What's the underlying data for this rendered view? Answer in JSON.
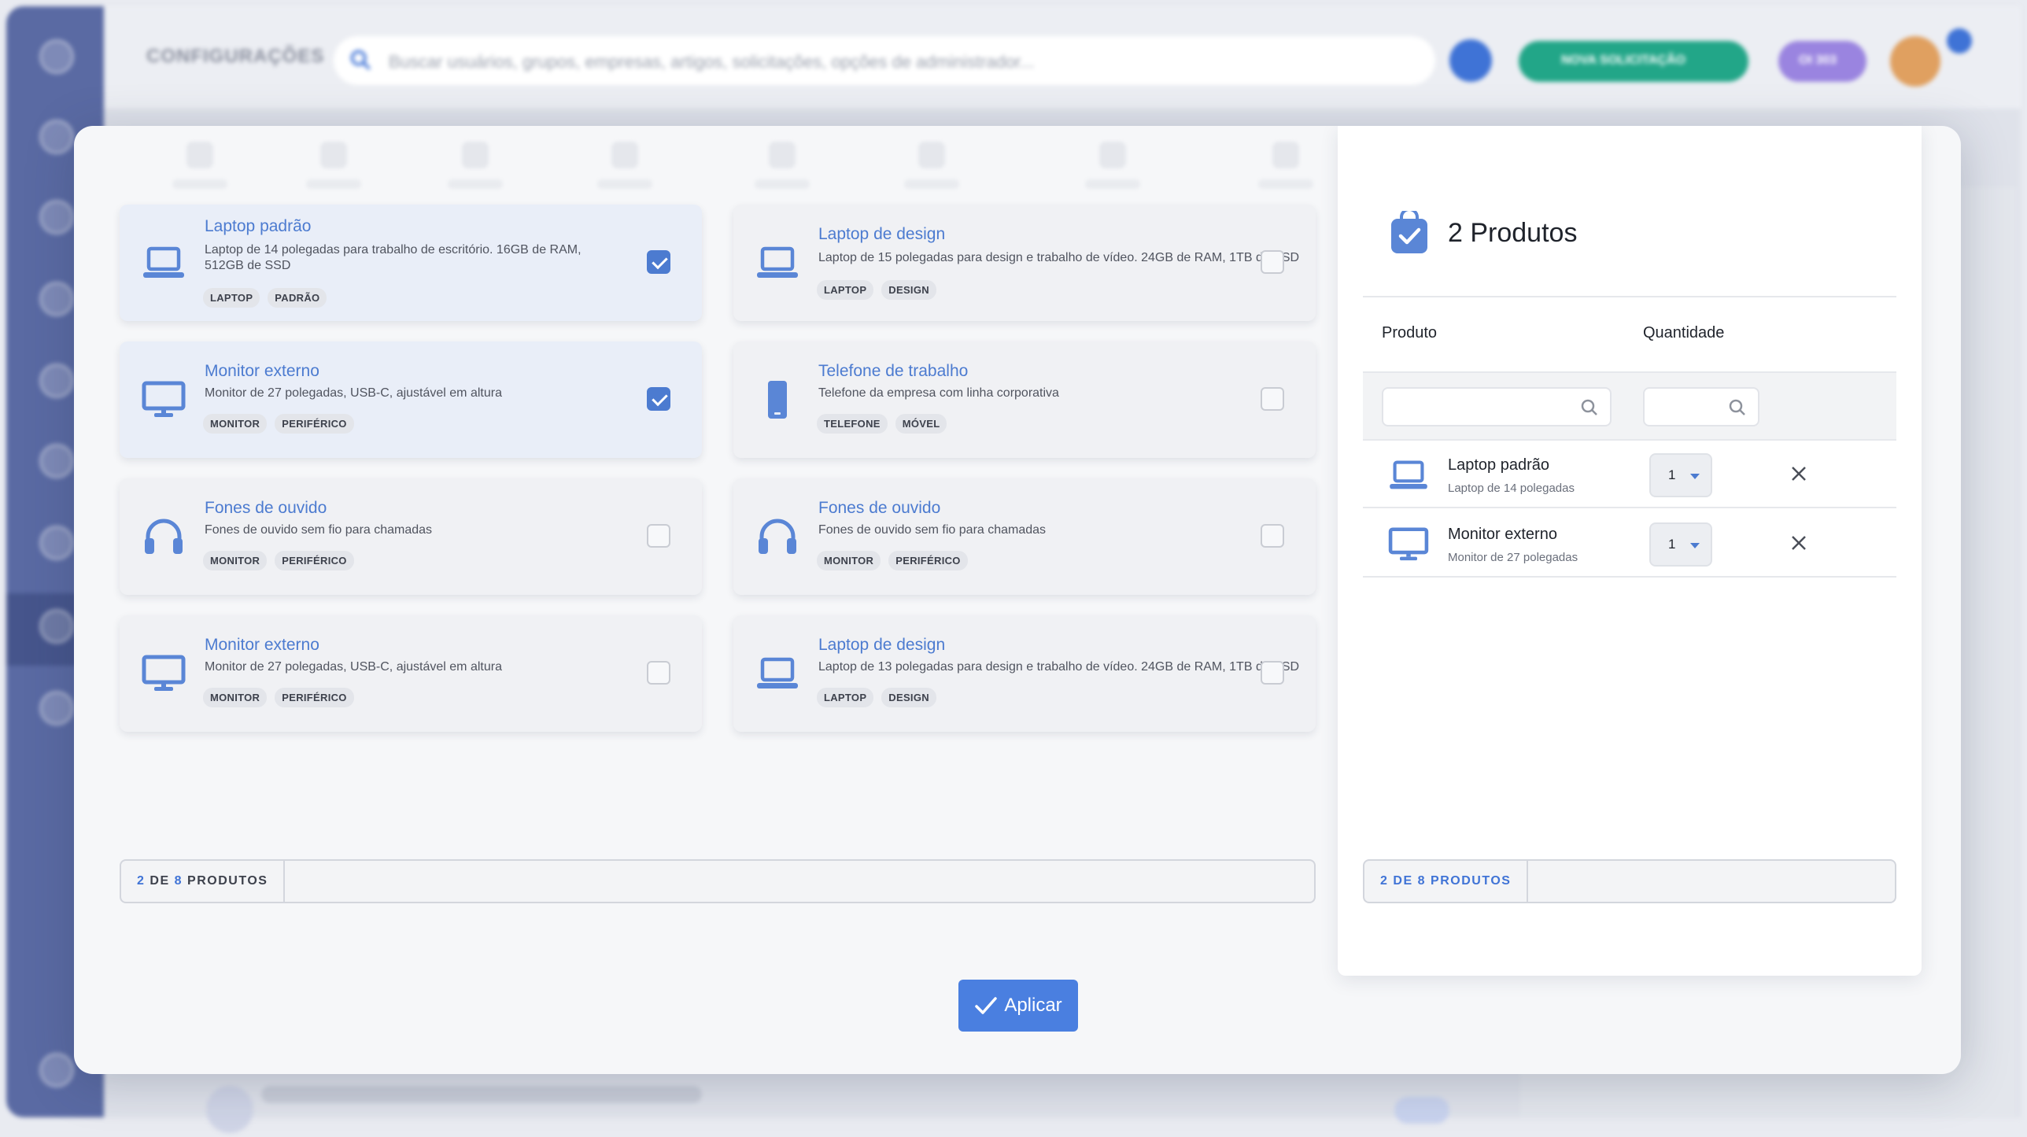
{
  "app": {
    "title": "CONFIGURAÇÕES",
    "search_placeholder": "Buscar usuários, grupos, empresas, artigos, solicitações, opções de administrador...",
    "new_request_label": "NOVA SOLICITAÇÃO",
    "pill_label": "OI 303",
    "accent": "#3f73d6"
  },
  "catalog": {
    "cards": [
      {
        "title": "Laptop padrão",
        "desc": "Laptop de 14 polegadas para trabalho de escritório. 16GB de RAM, 512GB de SSD",
        "tags": [
          "LAPTOP",
          "PADRÃO"
        ],
        "icon": "laptop-icon",
        "checked": true
      },
      {
        "title": "Laptop de design",
        "desc": "Laptop de 15 polegadas para design e trabalho de vídeo. 24GB de RAM, 1TB de SSD",
        "tags": [
          "LAPTOP",
          "DESIGN"
        ],
        "icon": "laptop-icon",
        "checked": false
      },
      {
        "title": "Monitor externo",
        "desc": "Monitor de 27 polegadas, USB-C, ajustável em altura",
        "tags": [
          "MONITOR",
          "PERIFÉRICO"
        ],
        "icon": "monitor-icon",
        "checked": true
      },
      {
        "title": "Telefone de trabalho",
        "desc": "Telefone da empresa com linha corporativa",
        "tags": [
          "TELEFONE",
          "MÓVEL"
        ],
        "icon": "phone-icon",
        "checked": false
      },
      {
        "title": "Fones de ouvido",
        "desc": "Fones de ouvido sem fio para chamadas",
        "tags": [
          "MONITOR",
          "PERIFÉRICO"
        ],
        "icon": "headphones-icon",
        "checked": false
      },
      {
        "title": "Fones de ouvido",
        "desc": "Fones de ouvido sem fio para chamadas",
        "tags": [
          "MONITOR",
          "PERIFÉRICO"
        ],
        "icon": "headphones-icon",
        "checked": false
      },
      {
        "title": "Monitor externo",
        "desc": "Monitor de 27 polegadas, USB-C, ajustável em altura",
        "tags": [
          "MONITOR",
          "PERIFÉRICO"
        ],
        "icon": "monitor-icon",
        "checked": false
      },
      {
        "title": "Laptop de design",
        "desc": "Laptop de 13 polegadas para design e trabalho de vídeo. 24GB de RAM, 1TB de SSD",
        "tags": [
          "LAPTOP",
          "DESIGN"
        ],
        "icon": "laptop-icon",
        "checked": false
      }
    ],
    "footer": {
      "selected": "2",
      "of": "DE",
      "total": "8",
      "unit": "PRODUTOS"
    }
  },
  "cart": {
    "title": "2 Produtos",
    "col_product": "Produto",
    "col_quantity": "Quantidade",
    "items": [
      {
        "name": "Laptop padrão",
        "sub": "Laptop de 14 polegadas",
        "qty": "1",
        "icon": "laptop-icon"
      },
      {
        "name": "Monitor externo",
        "sub": "Monitor de 27 polegadas",
        "qty": "1",
        "icon": "monitor-icon"
      }
    ],
    "footer": {
      "selected": "2",
      "of": "DE",
      "total": "8",
      "unit": "PRODUTOS"
    }
  },
  "apply_label": "Aplicar"
}
